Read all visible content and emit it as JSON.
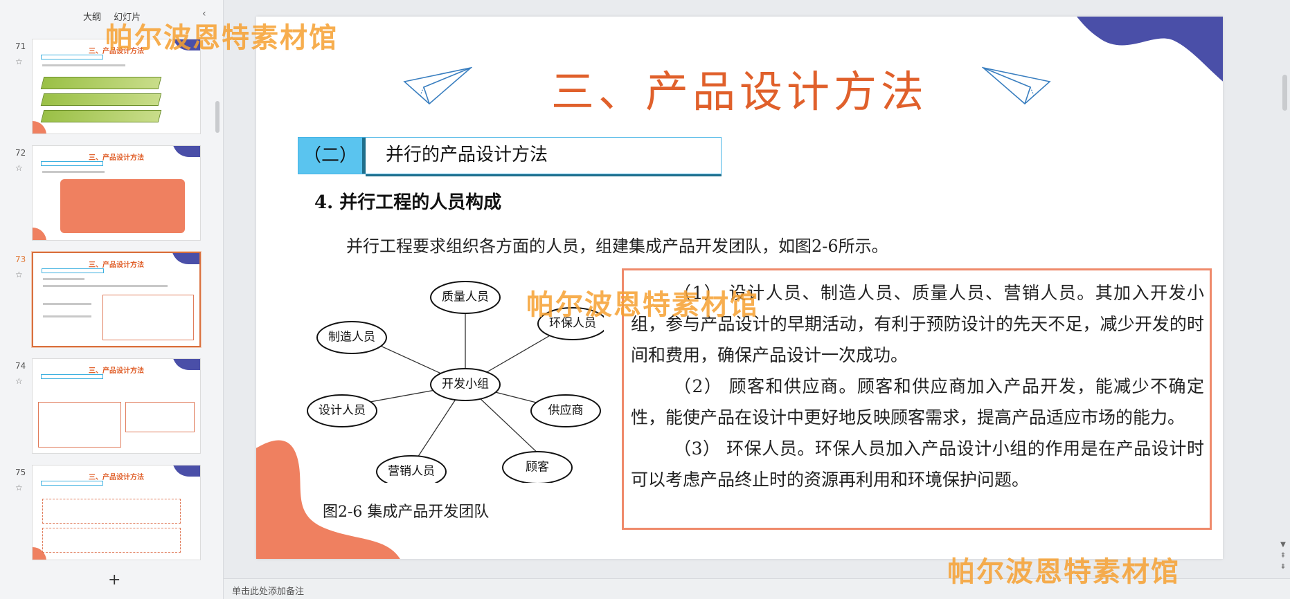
{
  "panel": {
    "tab_outline": "大纲",
    "tab_slides": "幻灯片",
    "add_icon": "plus-icon",
    "collapse_icon": "chevron-left-icon"
  },
  "thumbnails": [
    {
      "number": "71",
      "title": "三、产品设计方法"
    },
    {
      "number": "72",
      "title": "三、产品设计方法"
    },
    {
      "number": "73",
      "title": "三、产品设计方法"
    },
    {
      "number": "74",
      "title": "三、产品设计方法"
    },
    {
      "number": "75",
      "title": "三、产品设计方法"
    }
  ],
  "slide": {
    "title": "三、产品设计方法",
    "subheader_num": "（二）",
    "subheader_text": "并行的产品设计方法",
    "section_heading": "4. 并行工程的人员构成",
    "intro": "并行工程要求组织各方面的人员，组建集成产品开发团队，如图2-6所示。",
    "diagram": {
      "center": "开发小组",
      "nodes": [
        "质量人员",
        "环保人员",
        "供应商",
        "顾客",
        "营销人员",
        "设计人员",
        "制造人员"
      ]
    },
    "caption": "图2-6   集成产品开发团队",
    "paragraphs": [
      "（1）  设计人员、制造人员、质量人员、营销人员。其加入开发小组，参与产品设计的早期活动，有利于预防设计的先天不足，减少开发的时间和费用，确保产品设计一次成功。",
      "（2）  顾客和供应商。顾客和供应商加入产品开发，能减少不确定性，能使产品在设计中更好地反映顾客需求，提高产品适应市场的能力。",
      "（3）  环保人员。环保人员加入产品设计小组的作用是在产品设计时可以考虑产品终止时的资源再利用和环境保护问题。"
    ]
  },
  "notes": {
    "placeholder": "单击此处添加备注"
  },
  "watermark": "帕尔波恩特素材馆",
  "colors": {
    "accent": "#e0602b",
    "blob_blue": "#4a4fa8",
    "blob_orange": "#ef8060",
    "box_border": "#ef8a6b",
    "sub_blue": "#5ac4ef"
  }
}
